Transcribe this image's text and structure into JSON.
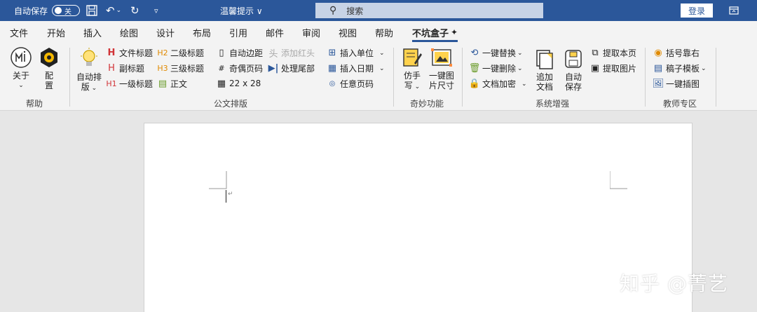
{
  "titlebar": {
    "autosave_label": "自动保存",
    "autosave_state": "关",
    "doc_title": "温馨提示 ∨",
    "search_placeholder": "搜索",
    "login_label": "登录"
  },
  "tabs": [
    "文件",
    "开始",
    "插入",
    "绘图",
    "设计",
    "布局",
    "引用",
    "邮件",
    "审阅",
    "视图",
    "帮助",
    "不坑盒子"
  ],
  "active_tab": "不坑盒子",
  "ribbon": {
    "help": {
      "about": "关于",
      "config_line1": "配",
      "config_line2": "置",
      "label": "帮助"
    },
    "format": {
      "auto_line1": "自动排",
      "auto_line2": "版",
      "doc_title": "文件标题",
      "sub_title": "副标题",
      "h1": "一级标题",
      "h2": "二级标题",
      "h3": "三级标题",
      "body": "正文",
      "auto_margin": "自动边距",
      "add_red_header": "添加红头",
      "odd_even_page": "奇偶页码",
      "process_tail": "处理尾部",
      "grid_size": "22 x 28",
      "insert_unit": "插入单位",
      "insert_date": "插入日期",
      "any_page": "任意页码",
      "label": "公文排版"
    },
    "magic": {
      "handwrite_line1": "仿手",
      "handwrite_line2": "写",
      "imgsize_line1": "一键图",
      "imgsize_line2": "片尺寸",
      "label": "奇妙功能"
    },
    "system": {
      "replace": "一键替换",
      "delete": "一键删除",
      "encrypt": "文档加密",
      "append_line1": "追加",
      "append_line2": "文档",
      "autosave_line1": "自动",
      "autosave_line2": "保存",
      "extract_page": "提取本页",
      "extract_image": "提取图片",
      "label": "系统增强"
    },
    "teacher": {
      "bracket": "括号靠右",
      "template": "稿子模板",
      "insert_pic": "一键插图",
      "label": "教师专区"
    }
  },
  "watermark": "知乎 @菁艺",
  "colors": {
    "brand": "#2b579a",
    "ribbon_bg": "#f3f3f3",
    "canvas_bg": "#e6e6e6"
  }
}
